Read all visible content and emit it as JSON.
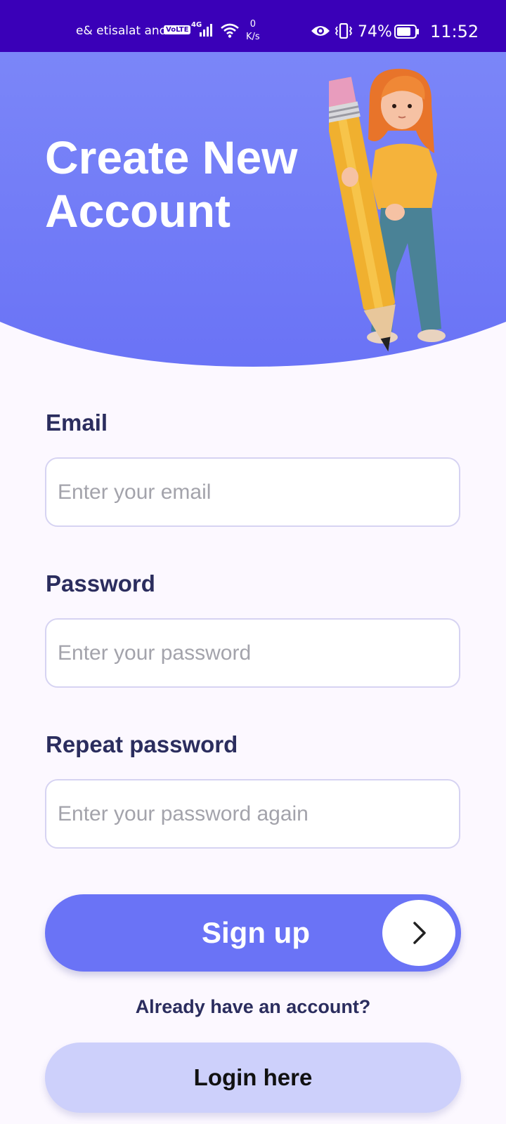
{
  "status_bar": {
    "carrier": "e& etisalat and",
    "volte": "VoLTE",
    "network": "4G",
    "net_speed_value": "0",
    "net_speed_unit": "K/s",
    "battery_percent": "74%",
    "time": "11:52"
  },
  "header": {
    "title": "Create New\n Account",
    "gradient_top": "#7b86f8",
    "gradient_bottom": "#6a73f6"
  },
  "form": {
    "email": {
      "label": "Email",
      "placeholder": "Enter your email",
      "value": ""
    },
    "password": {
      "label": "Password",
      "placeholder": "Enter your password",
      "value": ""
    },
    "repeat_password": {
      "label": "Repeat password",
      "placeholder": "Enter your password again",
      "value": ""
    }
  },
  "actions": {
    "signup_label": "Sign up",
    "signup_icon": "chevron-right-icon",
    "already_text": "Already have an account?",
    "login_label": "Login here"
  },
  "colors": {
    "status_bar": "#3a00b8",
    "accent": "#6a73f6",
    "login_button": "#cdd0fb",
    "label_text": "#2b2d5e",
    "background": "#fcf8ff"
  }
}
